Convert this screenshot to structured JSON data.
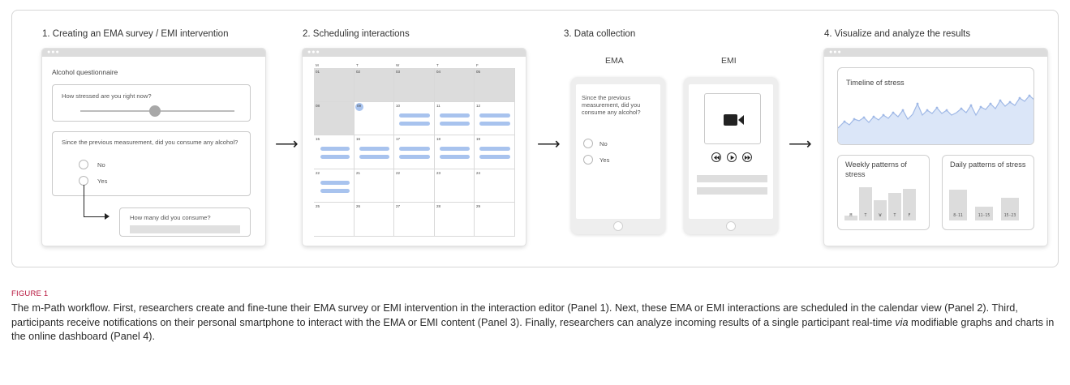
{
  "panels": {
    "p1_title": "1. Creating an EMA survey / EMI intervention",
    "p2_title": "2. Scheduling interactions",
    "p3_title": "3. Data collection",
    "p4_title": "4. Visualize and analyze the results"
  },
  "editor": {
    "questionnaire_title": "Alcohol questionnaire",
    "q1": "How stressed are you right now?",
    "q2": "Since the previous measurement, did you consume any alcohol?",
    "option_no": "No",
    "option_yes": "Yes",
    "q3": "How many did you consume?"
  },
  "calendar": {
    "weekdays": [
      "M",
      "T",
      "W",
      "T",
      "F"
    ],
    "days": [
      [
        "01",
        "02",
        "03",
        "04",
        "05"
      ],
      [
        "08",
        "09",
        "10",
        "11",
        "12"
      ],
      [
        "15",
        "16",
        "17",
        "18",
        "19"
      ],
      [
        "22",
        "21",
        "22",
        "23",
        "24"
      ],
      [
        "25",
        "26",
        "27",
        "28",
        "29"
      ]
    ]
  },
  "collection": {
    "ema_label": "EMA",
    "emi_label": "EMI",
    "ema_question": "Since the previous measurement, did you consume any alcohol?",
    "option_no": "No",
    "option_yes": "Yes"
  },
  "dashboard": {
    "timeline_title": "Timeline of stress",
    "weekly_title": "Weekly patterns of stress",
    "daily_title": "Daily patterns of stress",
    "weekly_labels": [
      "M",
      "T",
      "W",
      "T",
      "F"
    ],
    "weekly_values": [
      0.12,
      0.82,
      0.5,
      0.68,
      0.78
    ],
    "daily_labels": [
      "8-11",
      "11-15",
      "15-23"
    ],
    "daily_values": [
      0.76,
      0.33,
      0.55
    ]
  },
  "caption": {
    "label": "FIGURE 1",
    "text_1": "The m-Path workflow. First, researchers create and fine-tune their EMA survey or EMI intervention in the interaction editor (Panel 1). Next, these EMA or EMI interactions are scheduled in the calendar view (Panel 2). Third, participants receive notifications on their personal smartphone to interact with the EMA or EMI content (Panel 3). Finally, researchers can analyze incoming results of a single participant real-time ",
    "text_via": "via",
    "text_2": " modifiable graphs and charts in the online dashboard (Panel 4)."
  },
  "colors": {
    "accent_blue": "#a8c3ee",
    "chart_fill": "#dbe6f8",
    "chart_line": "#9fb8e6",
    "caption_label": "#b7153d"
  }
}
